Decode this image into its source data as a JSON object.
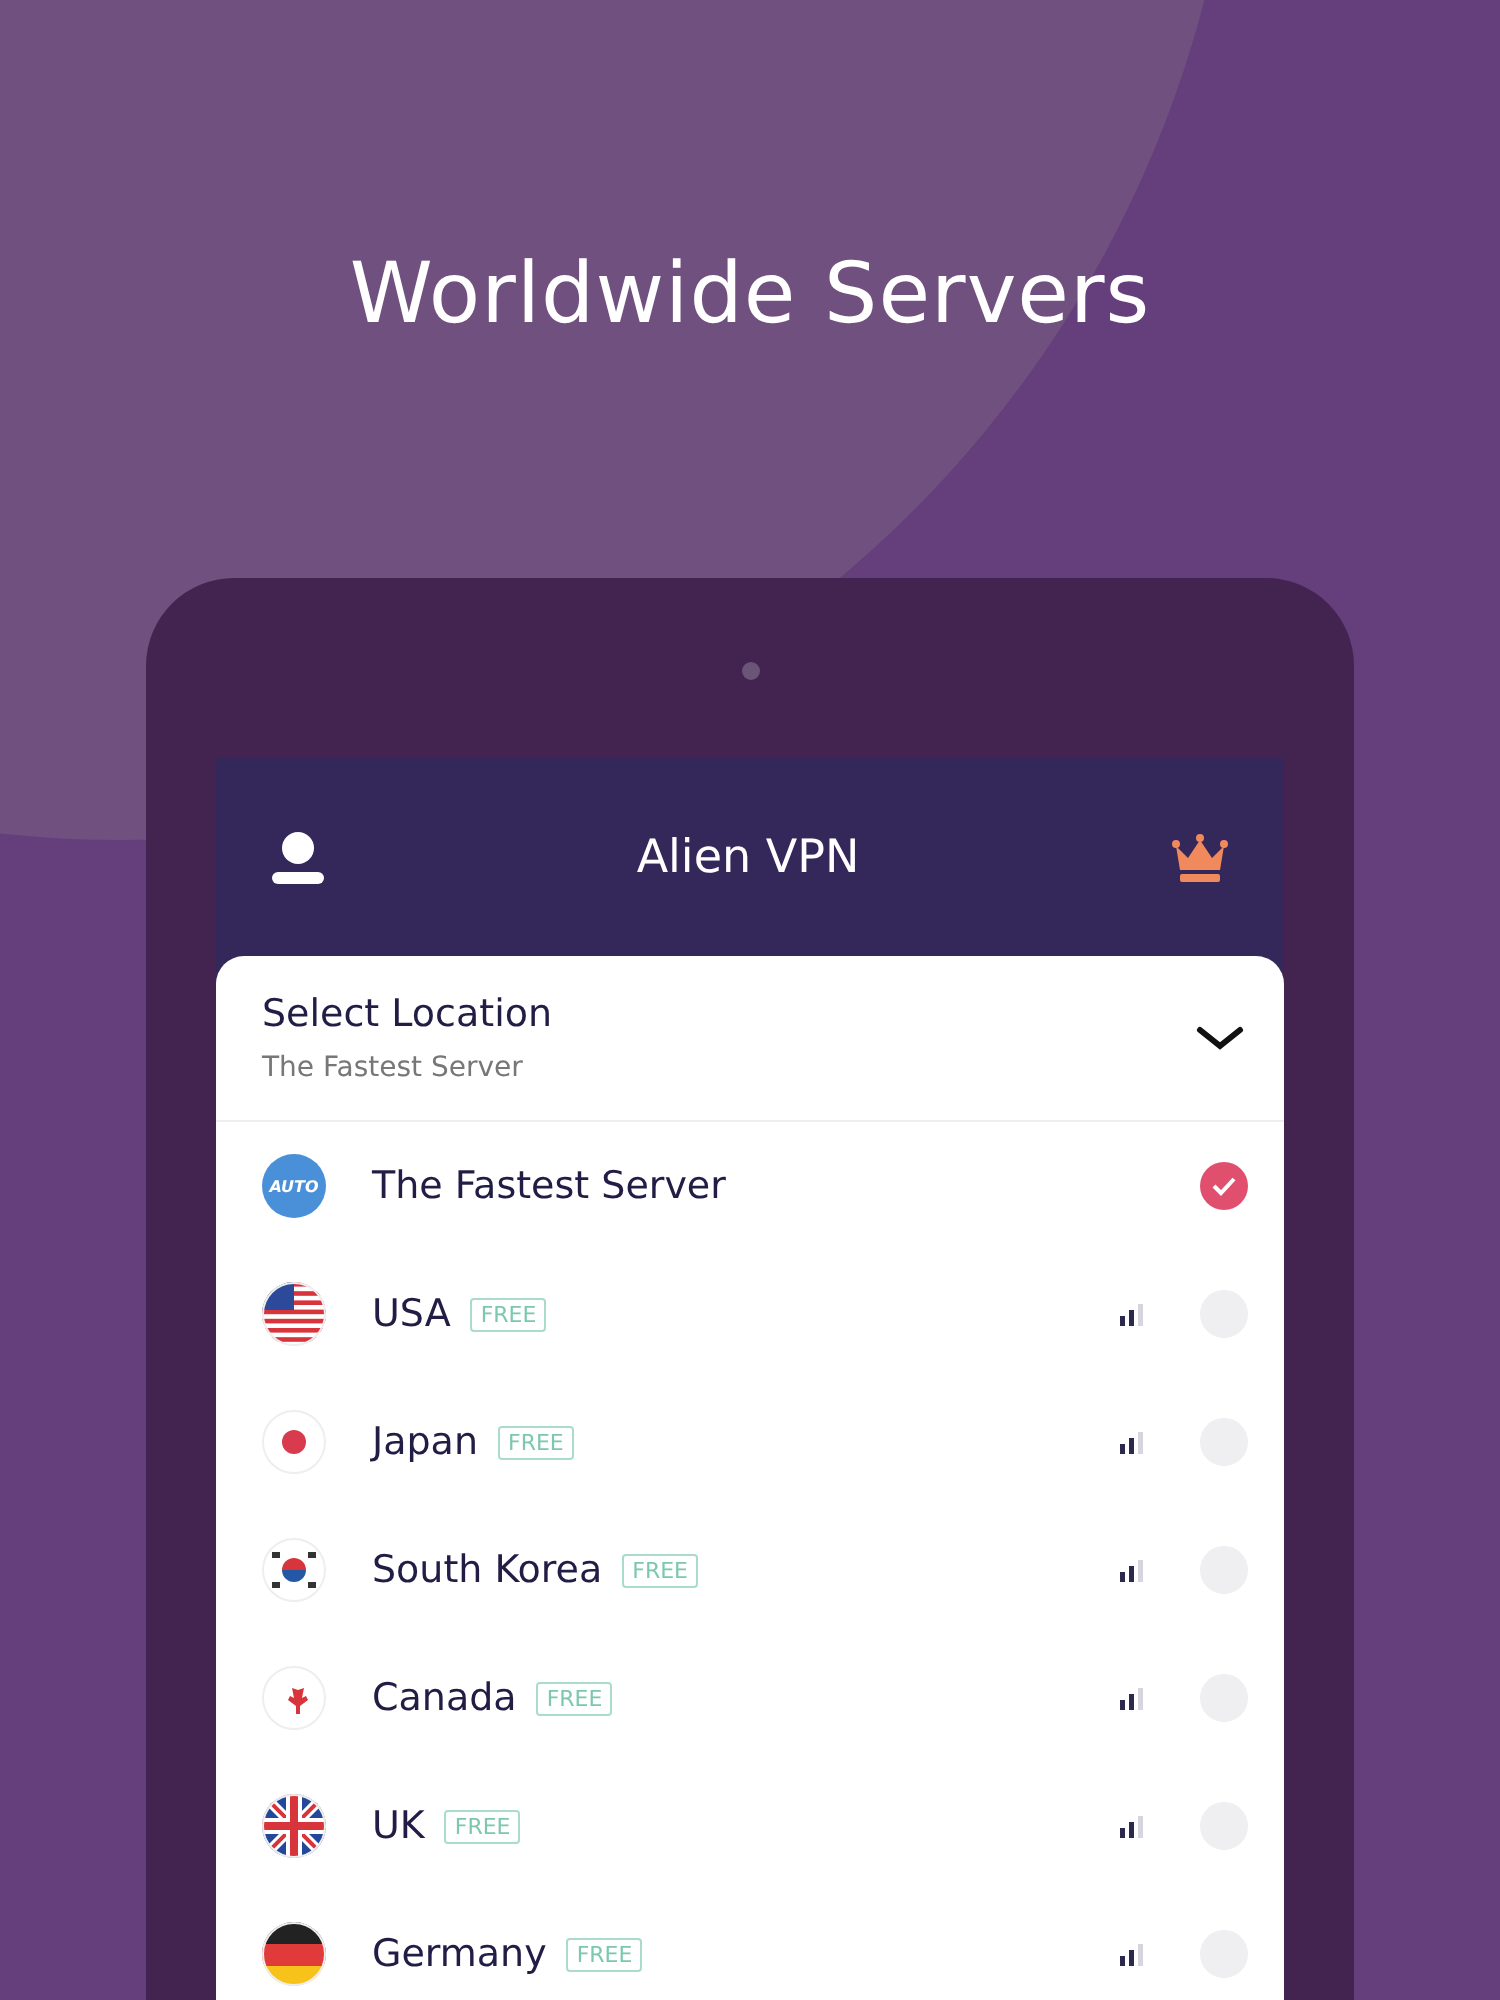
{
  "headline": "Worldwide Servers",
  "app_bar": {
    "title": "Alien VPN"
  },
  "location_card": {
    "title": "Select Location",
    "subtitle": "The Fastest Server",
    "expanded": true
  },
  "servers": [
    {
      "kind": "auto",
      "icon_text": "AUTO",
      "name": "The Fastest Server",
      "selected": true
    },
    {
      "kind": "country",
      "name": "USA",
      "badge": "FREE",
      "selected": false
    },
    {
      "kind": "country",
      "name": "Japan",
      "badge": "FREE",
      "selected": false
    },
    {
      "kind": "country",
      "name": "South Korea",
      "badge": "FREE",
      "selected": false
    },
    {
      "kind": "country",
      "name": "Canada",
      "badge": "FREE",
      "selected": false
    },
    {
      "kind": "country",
      "name": "UK",
      "badge": "FREE",
      "selected": false
    },
    {
      "kind": "country",
      "name": "Germany",
      "badge": "FREE",
      "selected": false
    }
  ]
}
